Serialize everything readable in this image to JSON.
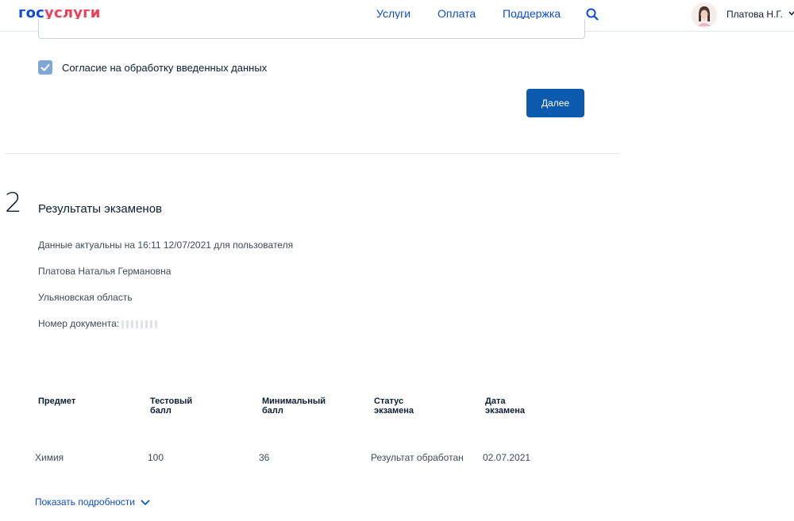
{
  "header": {
    "logo_part1": "гос",
    "logo_part2": "услуги",
    "nav": [
      "Услуги",
      "Оплата",
      "Поддержка"
    ],
    "user_name": "Платова Н.Г."
  },
  "form": {
    "consent_label": "Согласие на обработку введенных данных",
    "consent_checked": true,
    "next_button": "Далее"
  },
  "section": {
    "step_number": "2",
    "title": "Результаты экзаменов",
    "info_lines": [
      "Данные актуальны на 16:11 12/07/2021 для пользователя",
      "Платова Наталья Германовна",
      "Ульяновская область",
      "Номер документа:"
    ]
  },
  "table": {
    "headers": [
      "Предмет",
      "Тестовый балл",
      "Минимальный балл",
      "Статус экзамена",
      "Дата экзамена"
    ],
    "rows": [
      [
        "Химия",
        "100",
        "36",
        "Результат обработан",
        "02.07.2021"
      ]
    ]
  },
  "details_link": "Показать подробности",
  "colors": {
    "brand_blue": "#0d4cd3",
    "brand_red": "#ee3f58",
    "button_blue": "#0b5aad",
    "checkbox": "#7fa7d3"
  }
}
